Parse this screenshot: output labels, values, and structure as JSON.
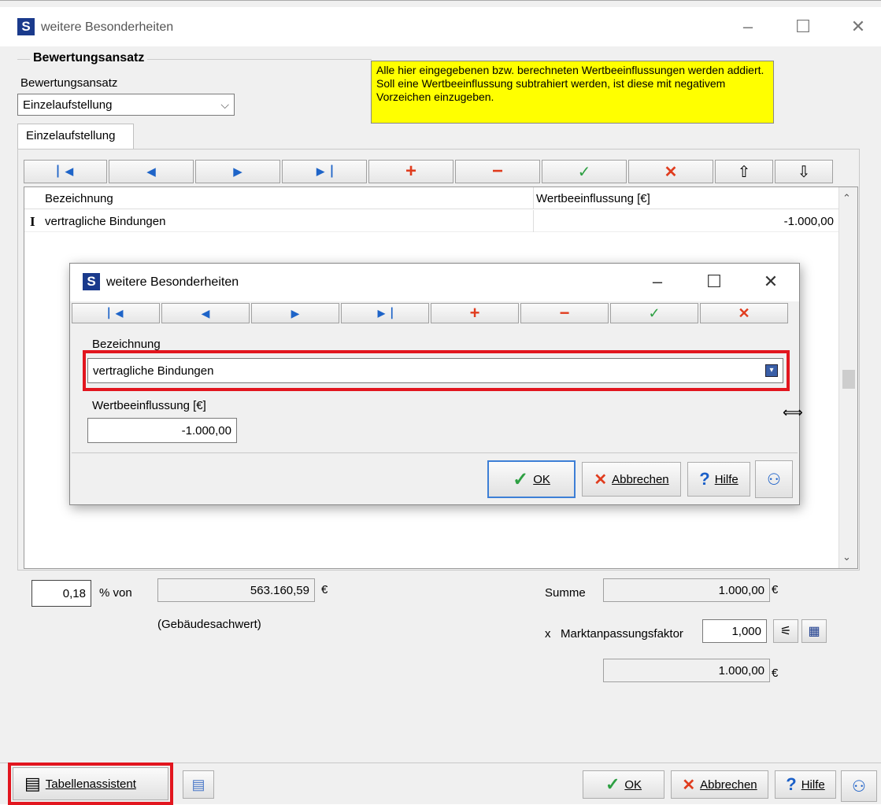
{
  "main": {
    "title": "weitere Besonderheiten",
    "app_icon_letter": "S",
    "section_title": "Bewertungsansatz",
    "approach_label": "Bewertungsansatz",
    "approach_value": "Einzelaufstellung",
    "tab_label": "Einzelaufstellung",
    "notice": "Alle hier eingegebenen bzw. berechneten Wertbeeinflussungen werden addiert. Soll eine Wertbeeinflussung subtrahiert werden, ist diese mit negativem Vorzeichen einzugeben.",
    "table": {
      "columns": [
        "Bezeichnung",
        "Wertbeeinflussung [€]"
      ],
      "rows": [
        {
          "indicator": "I",
          "name": "vertragliche Bindungen",
          "value": "-1.000,00"
        }
      ]
    },
    "percent_value": "0,18",
    "percent_of_label": "% von",
    "base_value": "563.160,59",
    "euro": "€",
    "base_caption": "(Gebäudesachwert)",
    "sum_label": "Summe",
    "sum_value": "1.000,00",
    "factor_prefix": "x",
    "factor_label": "Marktanpassungsfaktor",
    "factor_value": "1,000",
    "result_value": "1.000,00",
    "footer": {
      "wizard_label": "Tabellenassistent",
      "ok_label": "OK",
      "cancel_label": "Abbrechen",
      "help_label": "Hilfe",
      "help_glyph": "?"
    }
  },
  "dialog": {
    "title": "weitere Besonderheiten",
    "app_icon_letter": "S",
    "name_label": "Bezeichnung",
    "name_value": "vertragliche Bindungen",
    "value_label": "Wertbeeinflussung [€]",
    "value_value": "-1.000,00",
    "ok_label": "OK",
    "cancel_label": "Abbrechen",
    "help_label": "Hilfe",
    "help_glyph": "?"
  },
  "colors": {
    "highlight_red": "#e2161f",
    "notice_yellow": "#ffff00",
    "nav_blue": "#1e64c8",
    "add_red": "#e03c1e",
    "confirm_green": "#2ea043"
  }
}
